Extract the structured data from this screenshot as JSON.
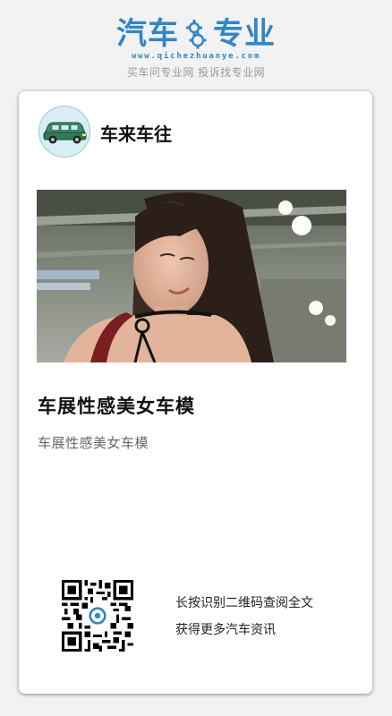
{
  "header": {
    "logo_left": "汽车",
    "logo_right": "专业",
    "logo_icon": "gear-icon",
    "url": "www.qichezhuanye.com",
    "slogan": "买车问专业网 投诉找专业网"
  },
  "card": {
    "author_name": "车来车往",
    "avatar_icon": "car-icon",
    "image_alt": "车展性感美女车模",
    "title": "车展性感美女车模",
    "summary": "车展性感美女车模"
  },
  "footer": {
    "qr_icon": "qr-code-icon",
    "line1": "长按识别二维码查阅全文",
    "line2": "获得更多汽车资讯"
  },
  "colors": {
    "brand": "#2f86c8",
    "background": "#f2f2f2",
    "card": "#ffffff"
  }
}
